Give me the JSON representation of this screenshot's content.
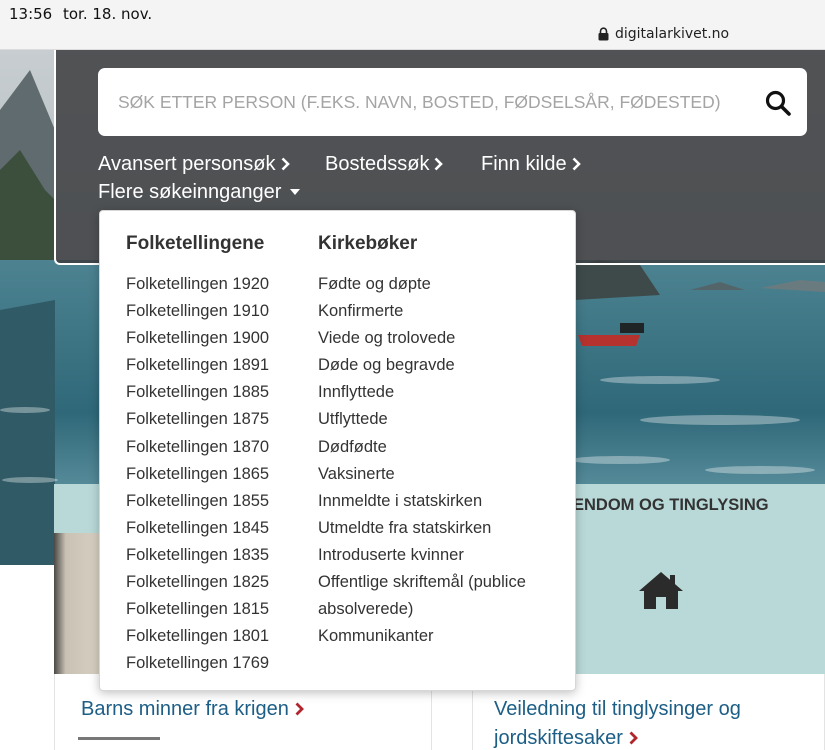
{
  "status_bar": {
    "time": "13:56",
    "date": "tor. 18. nov.",
    "url": "digitalarkivet.no"
  },
  "search": {
    "placeholder": "SØK ETTER PERSON (F.EKS. NAVN, BOSTED, FØDSELSÅR, FØDESTED)",
    "nav_links": [
      {
        "label": "Avansert personsøk"
      },
      {
        "label": "Bostedssøk"
      },
      {
        "label": "Finn kilde"
      },
      {
        "label": "Flere søkeinnganger"
      }
    ]
  },
  "dropdown": {
    "left_heading": "Folketellingene",
    "left_items": [
      "Folketellingen 1920",
      "Folketellingen 1910",
      "Folketellingen 1900",
      "Folketellingen 1891",
      "Folketellingen 1885",
      "Folketellingen 1875",
      "Folketellingen 1870",
      "Folketellingen 1865",
      "Folketellingen 1855",
      "Folketellingen 1845",
      "Folketellingen 1835",
      "Folketellingen 1825",
      "Folketellingen 1815",
      "Folketellingen 1801",
      "Folketellingen 1769"
    ],
    "right_heading": "Kirkebøker",
    "right_items": [
      "Fødte og døpte",
      "Konfirmerte",
      "Viede og trolovede",
      "Døde og begravde",
      "Innflyttede",
      "Utflyttede",
      "Dødfødte",
      "Vaksinerte",
      "Innmeldte i statskirken",
      "Utmeldte fra statskirken",
      "Introduserte kvinner",
      "Offentlige skriftemål (publice",
      "absolverede)",
      "Kommunikanter"
    ]
  },
  "cards": {
    "right_title": "ENDOM OG TINGLYSING",
    "bottom_left_link": "Barns minner fra krigen",
    "bottom_right_link_line1": "Veiledning til tinglysinger og",
    "bottom_right_link_line2": "jordskiftesaker"
  },
  "colors": {
    "panel": "#3c3e40",
    "card_teal": "#b9d9d8",
    "link_blue": "#1d5e86",
    "chevron_red": "#b0262d"
  },
  "icons": {
    "lock": "lock-icon",
    "search": "search-icon",
    "chevron_right": "chevron-right-icon",
    "caret_down": "caret-down-icon",
    "home": "home-icon"
  }
}
